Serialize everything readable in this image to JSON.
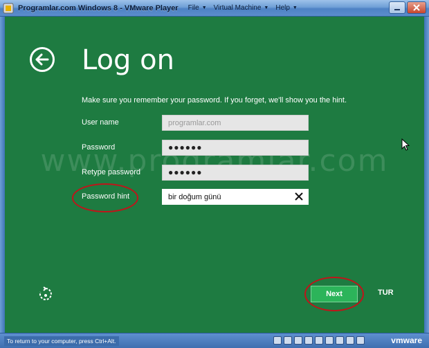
{
  "window": {
    "title": "Programlar.com Windows 8 - VMware Player",
    "menu": [
      {
        "label": "File"
      },
      {
        "label": "Virtual Machine"
      },
      {
        "label": "Help"
      }
    ]
  },
  "screen": {
    "watermark": "www.programlar.com",
    "title": "Log on",
    "instructions": "Make sure you remember your password. If you forget, we'll show you the hint.",
    "fields": {
      "user_name": {
        "label": "User name",
        "placeholder": "programlar.com"
      },
      "password": {
        "label": "Password",
        "value": "●●●●●●"
      },
      "retype_password": {
        "label": "Retype password",
        "value": "●●●●●●"
      },
      "password_hint": {
        "label": "Password hint",
        "value": "bir doğum günü"
      }
    },
    "next_label": "Next",
    "language": "TUR"
  },
  "statusbar": {
    "hint": "To return to your computer, press Ctrl+Alt.",
    "brand": "vmware"
  },
  "colors": {
    "screen_bg": "#1e7b41",
    "next_button": "#2cb45a",
    "highlight_ellipse": "#c0141a",
    "titlebar": "#5b8dcc"
  },
  "icons": [
    "app-icon",
    "back-arrow-icon",
    "clear-x-icon",
    "ease-of-access-icon",
    "mouse-cursor-icon"
  ]
}
